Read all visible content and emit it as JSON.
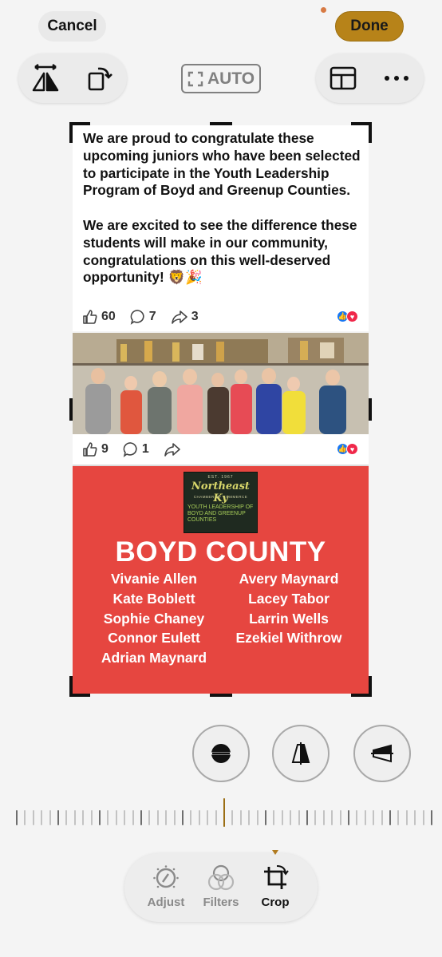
{
  "top_bar": {
    "cancel_label": "Cancel",
    "done_label": "Done",
    "auto_label": "AUTO"
  },
  "post1": {
    "paragraph1": "We are proud to congratulate these upcoming juniors who have been selected to participate in the Youth Leadership Program of Boyd and Greenup Counties.",
    "paragraph2": "We are excited to see the difference these students will make in our community, congratulations on this well-deserved opportunity! 🦁🎉",
    "likes": "60",
    "comments": "7",
    "shares": "3"
  },
  "post2": {
    "likes": "9",
    "comments": "1"
  },
  "graphic": {
    "logo_est": "EST. 1967",
    "logo_title": "Northeast Ky",
    "logo_subtitle": "CHAMBER OF COMMERCE",
    "logo_description": "YOUTH LEADERSHIP OF BOYD AND GREENUP COUNTIES",
    "county_title": "BOYD COUNTY",
    "names_left": [
      "Vivanie Allen",
      "Kate Boblett",
      "Sophie Chaney",
      "Connor Eulett",
      "Adrian Maynard"
    ],
    "names_right": [
      "Avery Maynard",
      "Lacey Tabor",
      "Larrin Wells",
      "Ezekiel Withrow"
    ]
  },
  "bottom_tabs": {
    "adjust_label": "Adjust",
    "filters_label": "Filters",
    "crop_label": "Crop"
  },
  "colors": {
    "done_gold": "#b78319",
    "graphic_red": "#e64640",
    "dial_center": "#9b6e14"
  }
}
